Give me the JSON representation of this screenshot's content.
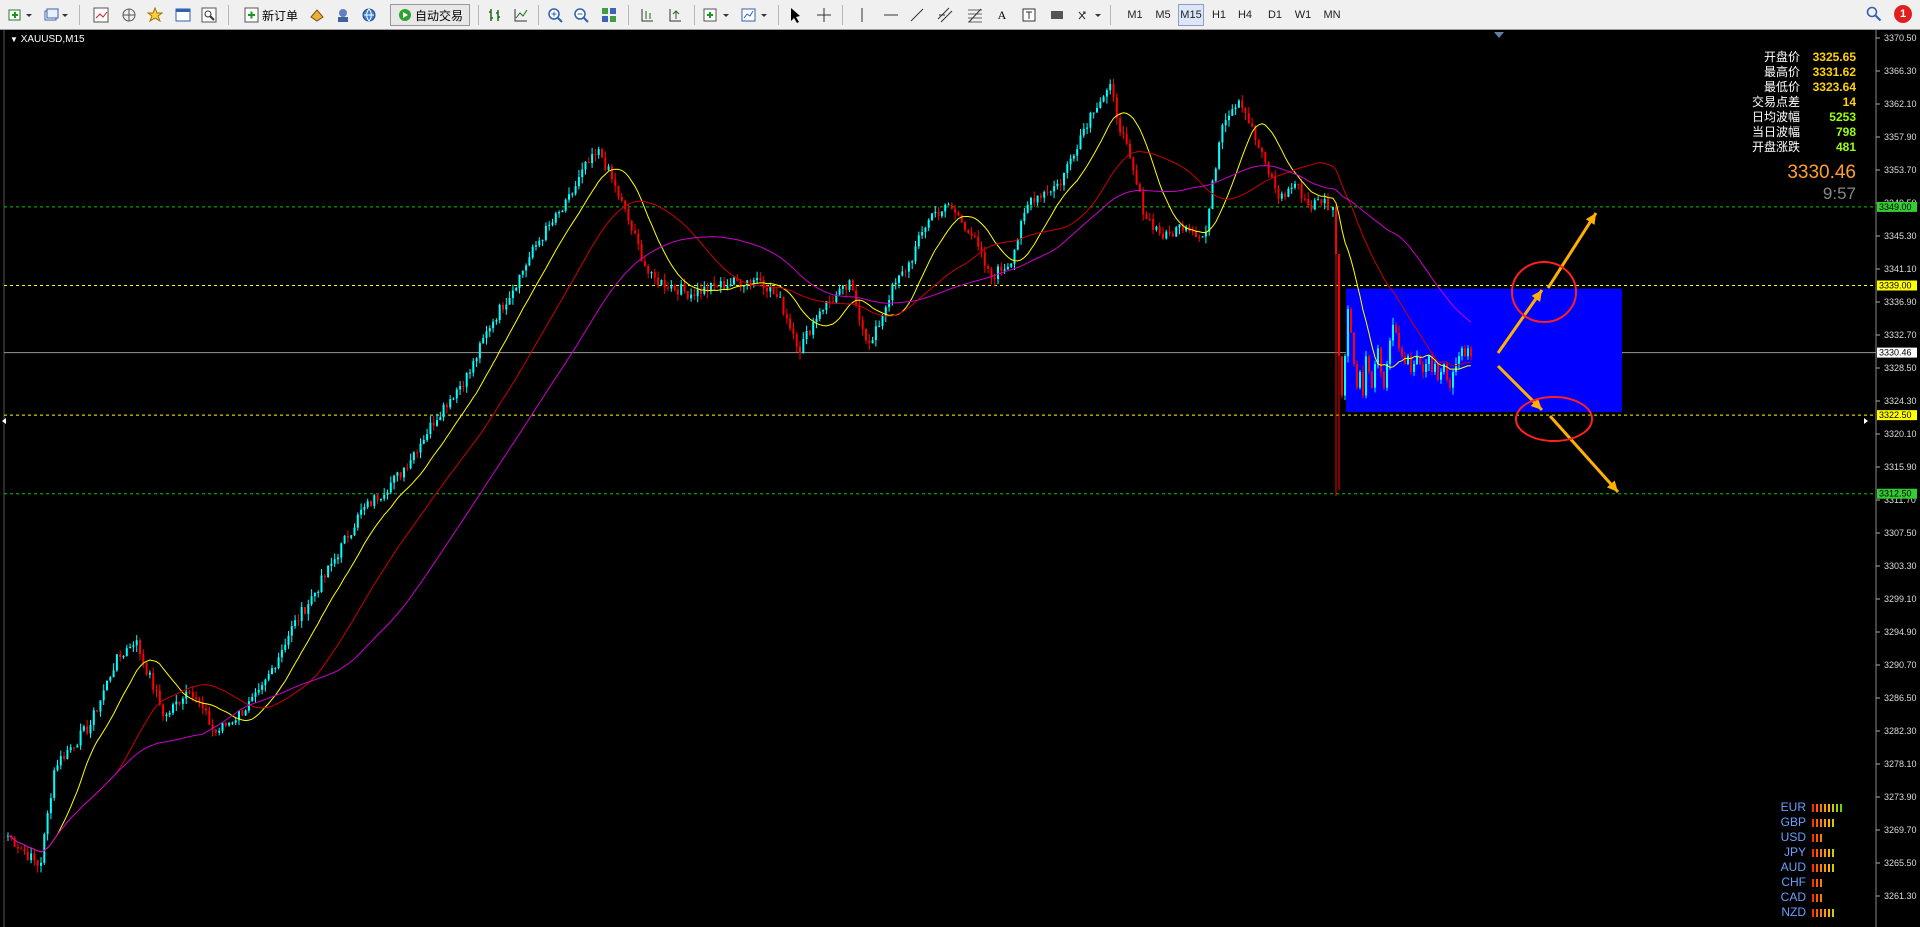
{
  "toolbar": {
    "new_order_label": "新订单",
    "auto_trading_label": "自动交易",
    "timeframes": [
      "M1",
      "M5",
      "M15",
      "H1",
      "H4",
      "D1",
      "W1",
      "MN"
    ]
  },
  "chart": {
    "symbol_label": "XAUUSD,M15",
    "current_price": "3330.46",
    "countdown": "9:57",
    "price_axis_ticks": [
      "3370.50",
      "3366.30",
      "3362.10",
      "3357.90",
      "3353.70",
      "3349.50",
      "3345.30",
      "3341.10",
      "3336.90",
      "3332.70",
      "3328.50",
      "3324.30",
      "3320.10",
      "3315.90",
      "3311.70",
      "3307.50",
      "3303.30",
      "3299.10",
      "3294.90",
      "3290.70",
      "3286.50",
      "3282.30",
      "3278.10",
      "3273.90",
      "3269.70",
      "3265.50",
      "3261.30"
    ],
    "level_labels": [
      "3349.00",
      "3339.00",
      "3330.46",
      "3322.50",
      "3312.50"
    ],
    "colors": {
      "bull": "#00ffff",
      "bear": "#ff0000",
      "ma_fast": "#ffff00",
      "ma_mid": "#cc0000",
      "ma_slow": "#cc00cc",
      "level": "#00cc00",
      "level_yellow": "#ffff00",
      "range_box": "#0000ff",
      "arrow": "#ffb000",
      "circle": "#ff2020"
    }
  },
  "info_panel": {
    "labels": [
      "开盘价",
      "最高价",
      "最低价",
      "交易点差",
      "日均波幅",
      "当日波幅",
      "开盘涨跌"
    ],
    "values": [
      "3325.65",
      "3331.62",
      "3323.64",
      "14",
      "5253",
      "798",
      "481"
    ]
  },
  "currency_strength": {
    "names": [
      "EUR",
      "GBP",
      "USD",
      "JPY",
      "AUD",
      "CHF",
      "CAD",
      "NZD"
    ],
    "strength_bars": [
      8,
      6,
      3,
      6,
      6,
      3,
      3,
      6
    ]
  }
}
